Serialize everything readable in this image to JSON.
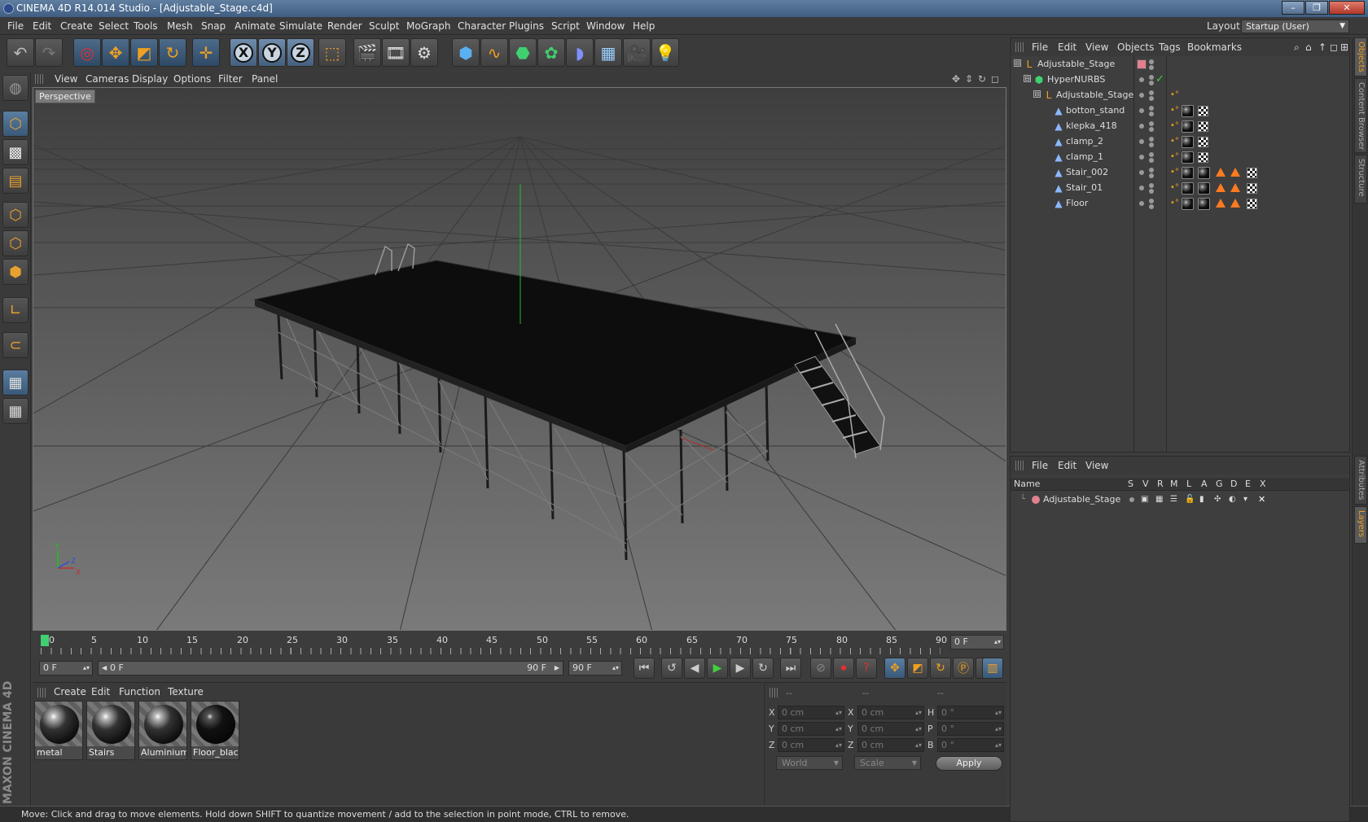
{
  "app": {
    "title": "CINEMA 4D R14.014 Studio - [Adjustable_Stage.c4d]",
    "window_controls": {
      "minimize": "–",
      "maximize": "❐",
      "close": "✕"
    }
  },
  "menubar": {
    "items": [
      "File",
      "Edit",
      "Create",
      "Select",
      "Tools",
      "Mesh",
      "Snap",
      "Animate",
      "Simulate",
      "Render",
      "Sculpt",
      "MoGraph",
      "Character",
      "Plugins",
      "Script",
      "Window",
      "Help"
    ],
    "layout_label": "Layout:",
    "layout_value": "Startup (User)"
  },
  "toolbar": {
    "icons": [
      "undo-icon",
      "redo-icon",
      "live-selection-icon",
      "move-icon",
      "scale-icon",
      "rotate-icon",
      "recent-tool-icon",
      "x-axis-lock-icon",
      "y-axis-lock-icon",
      "z-axis-lock-icon",
      "coordinate-system-icon",
      "render-view-icon",
      "render-picture-viewer-icon",
      "edit-render-settings-icon",
      "cube-primitive-icon",
      "spline-icon",
      "nurbs-icon",
      "array-icon",
      "deformer-icon",
      "floor-environment-icon",
      "camera-icon",
      "light-icon"
    ],
    "axis_labels": [
      "X",
      "Y",
      "Z"
    ]
  },
  "left_toolbar": {
    "icons": [
      "make-editable-icon",
      "model-mode-icon",
      "texture-mode-icon",
      "workplane-mode-icon",
      "points-mode-icon",
      "edges-mode-icon",
      "polygons-mode-icon",
      "axis-mode-icon",
      "magnet-icon",
      "snap-icon",
      "locked-workplane-icon"
    ],
    "brand": "MAXON CINEMA 4D"
  },
  "viewport": {
    "menu": [
      "View",
      "Cameras",
      "Display",
      "Options",
      "Filter",
      "Panel"
    ],
    "label": "Perspective",
    "axis_labels": {
      "x": "X",
      "y": "Y",
      "z": "Z"
    }
  },
  "timeline": {
    "ticks": [
      "0",
      "5",
      "10",
      "15",
      "20",
      "25",
      "30",
      "35",
      "40",
      "45",
      "50",
      "55",
      "60",
      "65",
      "70",
      "75",
      "80",
      "85",
      "90"
    ],
    "current_frame": "0 F",
    "start_frame": "0 F",
    "range_start": "0 F",
    "range_end": "90 F",
    "end_frame": "90 F"
  },
  "material_manager": {
    "menu": [
      "Create",
      "Edit",
      "Function",
      "Texture"
    ],
    "materials": [
      {
        "name": "metal"
      },
      {
        "name": "Stairs"
      },
      {
        "name": "Aluminium"
      },
      {
        "name": "Floor_black"
      }
    ]
  },
  "coordinates": {
    "headers": [
      "--",
      "--",
      "--"
    ],
    "rows": [
      {
        "label1": "X",
        "val1": "0 cm",
        "label2": "X",
        "val2": "0 cm",
        "label3": "H",
        "val3": "0 °"
      },
      {
        "label1": "Y",
        "val1": "0 cm",
        "label2": "Y",
        "val2": "0 cm",
        "label3": "P",
        "val3": "0 °"
      },
      {
        "label1": "Z",
        "val1": "0 cm",
        "label2": "Z",
        "val2": "0 cm",
        "label3": "B",
        "val3": "0 °"
      }
    ],
    "world": "World",
    "scale": "Scale",
    "apply": "Apply"
  },
  "object_manager": {
    "menu": [
      "File",
      "Edit",
      "View",
      "Objects",
      "Tags",
      "Bookmarks"
    ],
    "objects": [
      {
        "name": "Adjustable_Stage",
        "level": 0,
        "tree": "⊟"
      },
      {
        "name": "HyperNURBS",
        "level": 1,
        "tree": "⊟"
      },
      {
        "name": "Adjustable_Stage",
        "level": 2,
        "tree": "⊟"
      },
      {
        "name": "botton_stand",
        "level": 3,
        "tree": ""
      },
      {
        "name": "klepka_418",
        "level": 3,
        "tree": ""
      },
      {
        "name": "clamp_2",
        "level": 3,
        "tree": ""
      },
      {
        "name": "clamp_1",
        "level": 3,
        "tree": ""
      },
      {
        "name": "Stair_002",
        "level": 3,
        "tree": ""
      },
      {
        "name": "Stair_01",
        "level": 3,
        "tree": ""
      },
      {
        "name": "Floor",
        "level": 3,
        "tree": ""
      }
    ],
    "check": "✓"
  },
  "layer_manager": {
    "menu": [
      "File",
      "Edit",
      "View"
    ],
    "columns": [
      "Name",
      "S",
      "V",
      "R",
      "M",
      "L",
      "A",
      "G",
      "D",
      "E",
      "X"
    ],
    "layers": [
      {
        "name": "Adjustable_Stage"
      }
    ]
  },
  "side_tabs": [
    "Objects",
    "Content Browser",
    "Structure",
    "Attributes",
    "Layers"
  ],
  "status": {
    "text": "Move: Click and drag to move elements. Hold down SHIFT to quantize movement / add to the selection in point mode, CTRL to remove."
  },
  "colors": {
    "accent": "#f0a020",
    "layer_color": "#e08090",
    "y_axis": "#20c020"
  }
}
